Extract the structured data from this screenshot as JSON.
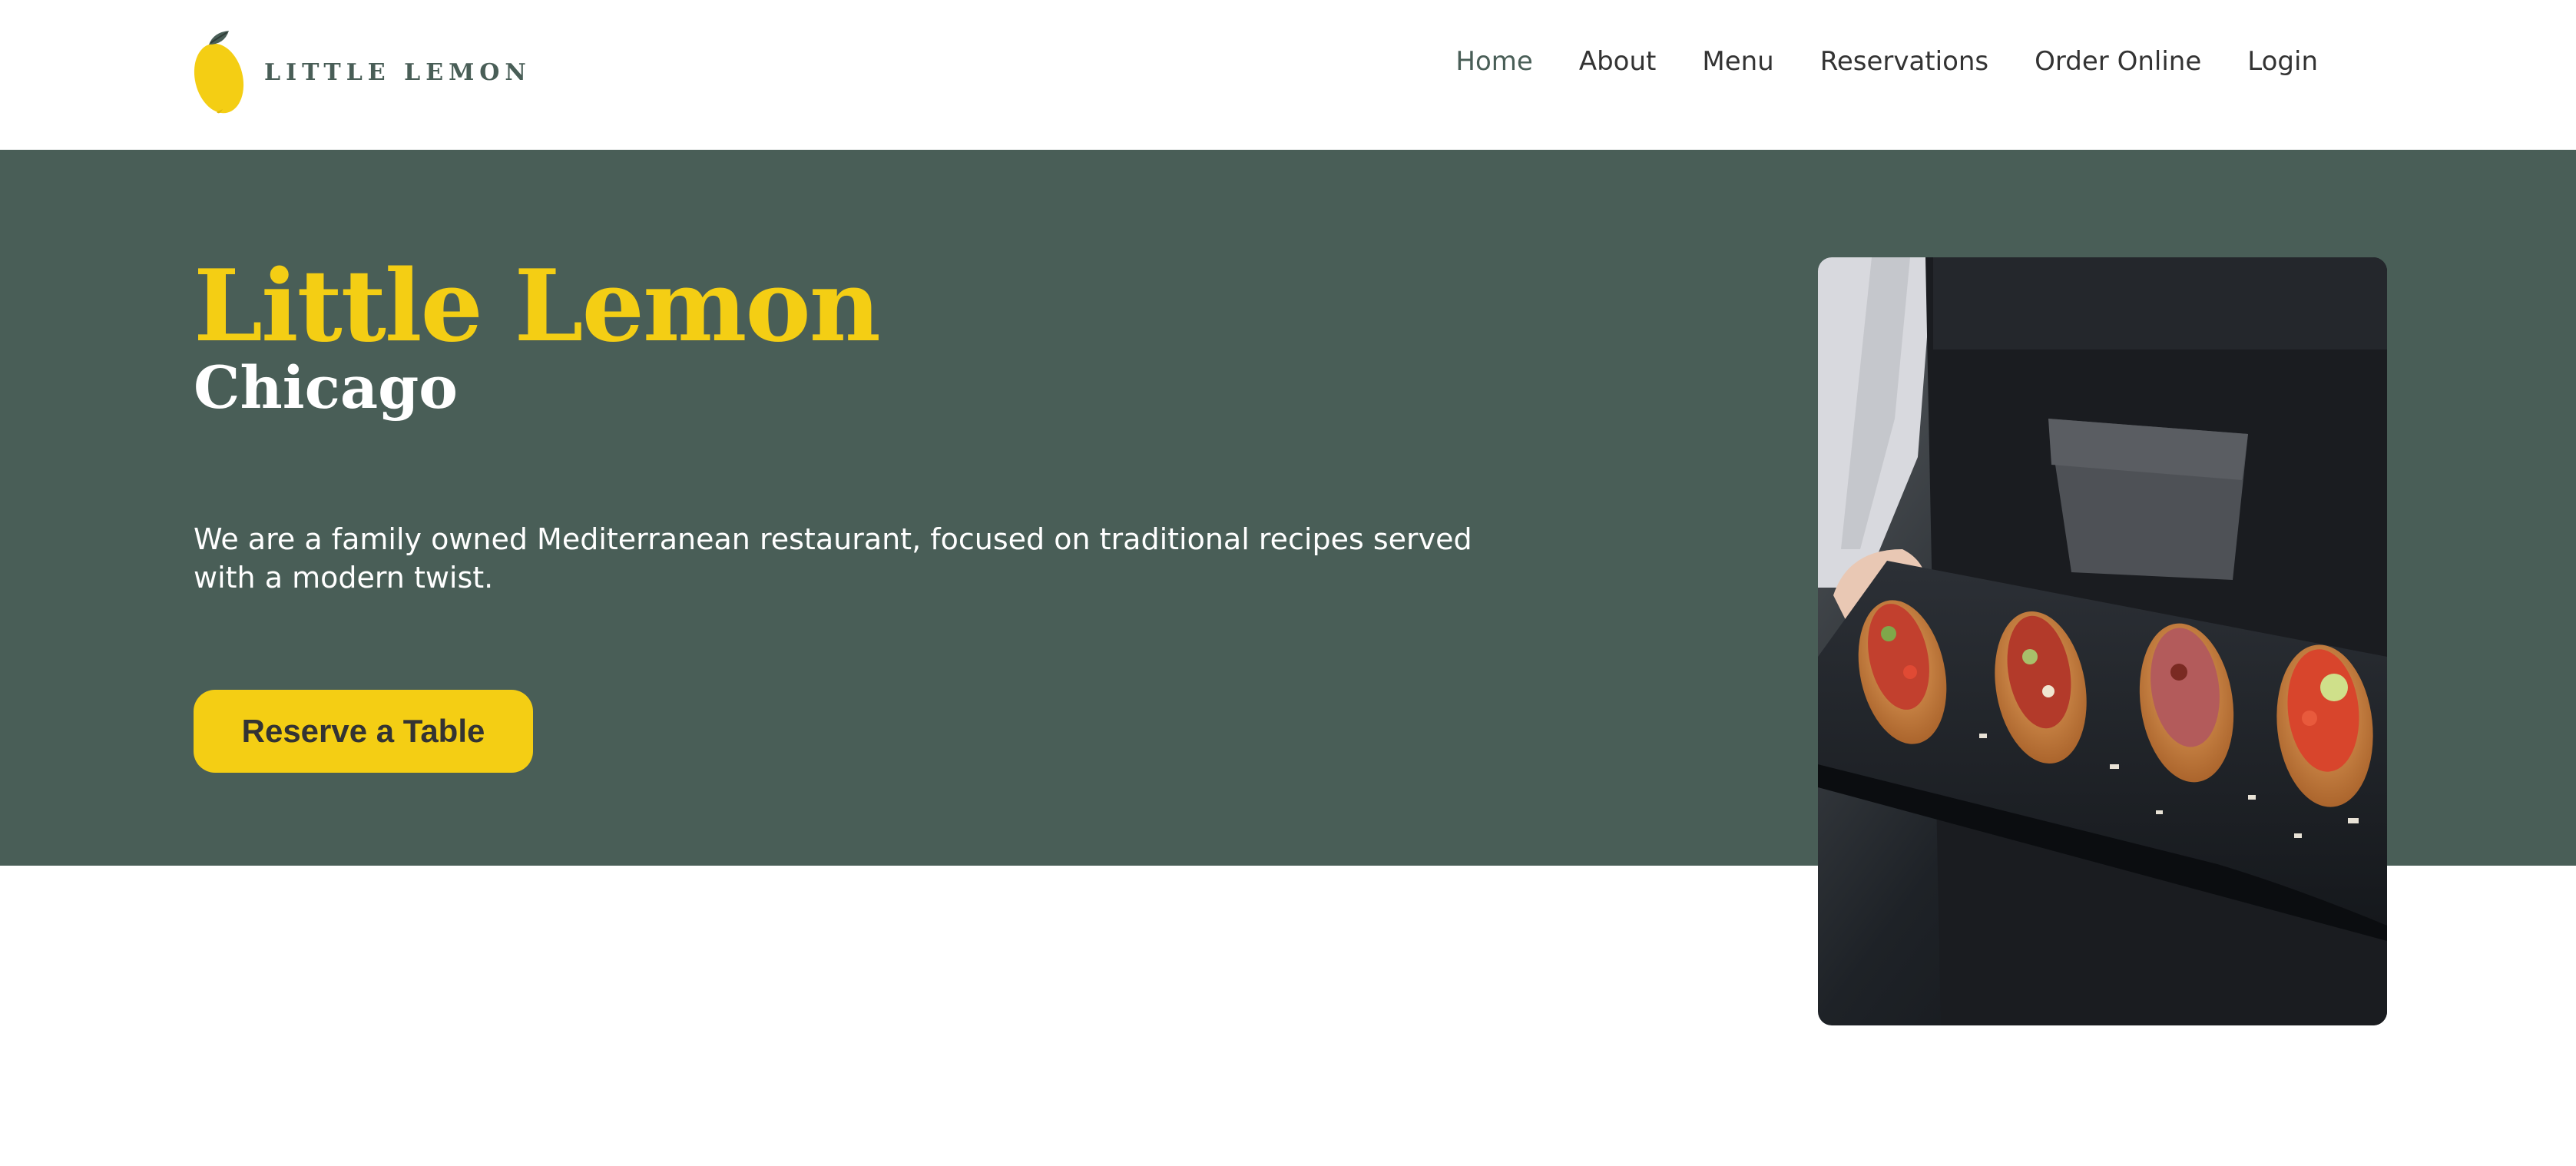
{
  "brand": {
    "name": "LITTLE LEMON",
    "icon": "lemon-icon",
    "colors": {
      "primary": "#495e57",
      "accent": "#f4ce14",
      "text": "#333333"
    }
  },
  "nav": {
    "items": [
      {
        "label": "Home",
        "active": true
      },
      {
        "label": "About"
      },
      {
        "label": "Menu"
      },
      {
        "label": "Reservations"
      },
      {
        "label": "Order Online"
      },
      {
        "label": "Login"
      }
    ]
  },
  "hero": {
    "title": "Little Lemon",
    "subtitle": "Chicago",
    "description": "We are a family owned Mediterranean restaurant, focused on traditional recipes served with a modern twist.",
    "cta_label": "Reserve a Table",
    "image_subject": "chef-serving-bruschetta-photo"
  }
}
